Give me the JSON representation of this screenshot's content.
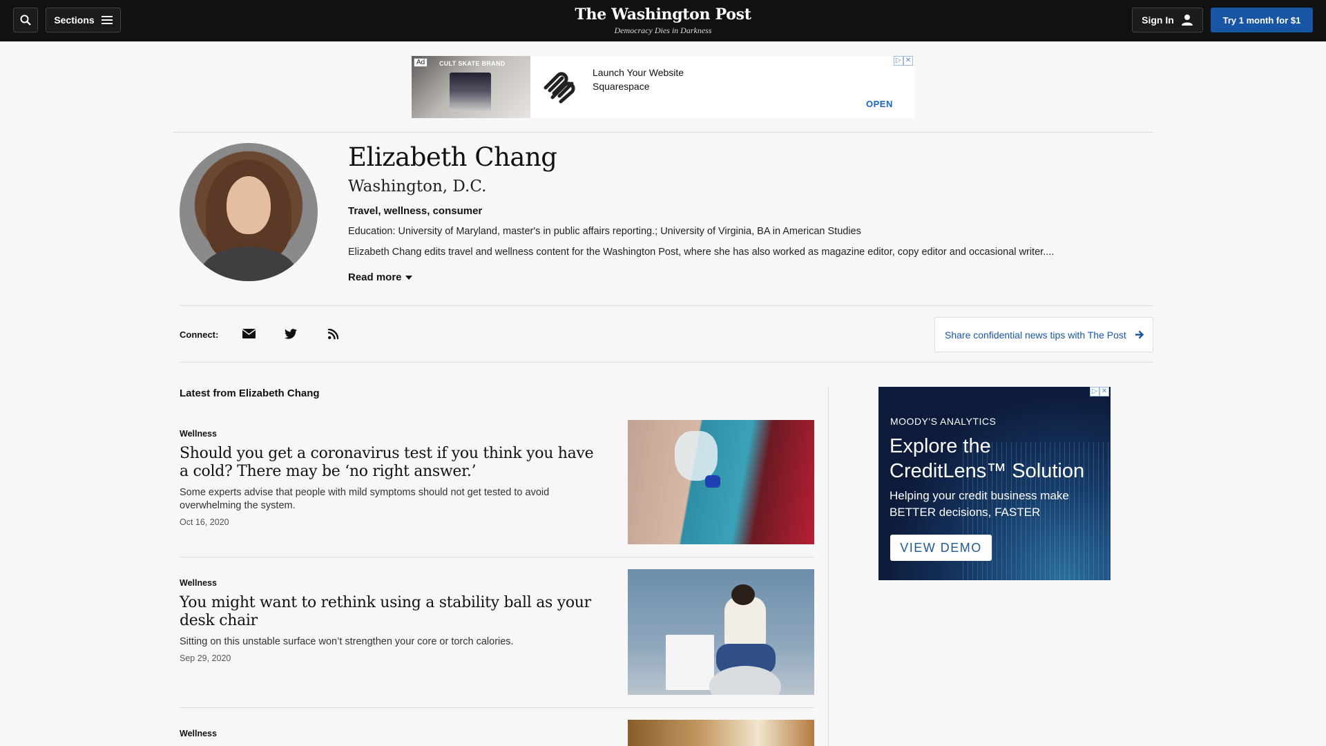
{
  "header": {
    "logo": "The Washington Post",
    "tagline": "Democracy Dies in Darkness",
    "sections_label": "Sections",
    "sign_in_label": "Sign In",
    "try_label": "Try 1 month for $1"
  },
  "banner_ad": {
    "ad_label": "Ad",
    "image_brand_text": "CULT SKATE BRAND",
    "title": "Launch Your Website",
    "advertiser": "Squarespace",
    "cta": "OPEN"
  },
  "author": {
    "name": "Elizabeth Chang",
    "location": "Washington, D.C.",
    "topics": "Travel, wellness, consumer",
    "education": "Education: University of Maryland, master's in public affairs reporting.; University of Virginia, BA in American Studies",
    "bio": "Elizabeth Chang edits travel and wellness content for the Washington Post, where she has also worked as magazine editor, copy editor and occasional writer....",
    "read_more": "Read more"
  },
  "connect": {
    "label": "Connect:",
    "icons": [
      "email-icon",
      "twitter-icon",
      "rss-icon"
    ],
    "tips_label": "Share confidential news tips with The Post"
  },
  "latest": {
    "heading": "Latest from Elizabeth Chang",
    "articles": [
      {
        "kicker": "Wellness",
        "headline": "Should you get a coronavirus test if you think you have a cold? There may be ‘no right answer.’",
        "blurb": "Some experts advise that people with mild symptoms should not get tested to avoid overwhelming the system.",
        "date": "Oct 16, 2020"
      },
      {
        "kicker": "Wellness",
        "headline": "You might want to rethink using a stability ball as your desk chair",
        "blurb": "Sitting on this unstable surface won’t strengthen your core or torch calories.",
        "date": "Sep 29, 2020"
      },
      {
        "kicker": "Wellness"
      }
    ]
  },
  "side_ad": {
    "brand": "MOODY'S ANALYTICS",
    "headline": "Explore the CreditLens™ Solution",
    "subhead": "Helping your credit business make BETTER decisions, FASTER",
    "cta": "VIEW DEMO"
  },
  "colors": {
    "topbar": "#111111",
    "accent_blue": "#1955a5",
    "page_bg": "#f7f7f7"
  }
}
